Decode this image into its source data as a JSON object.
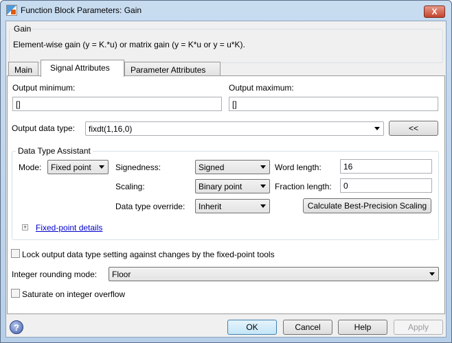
{
  "window": {
    "title": "Function Block Parameters: Gain",
    "close": "X"
  },
  "block": {
    "group_label": "Gain",
    "description": "Element-wise gain (y = K.*u) or matrix gain (y = K*u or y = u*K)."
  },
  "tabs": [
    {
      "label": "Main"
    },
    {
      "label": "Signal Attributes"
    },
    {
      "label": "Parameter Attributes"
    }
  ],
  "signal": {
    "out_min_label": "Output minimum:",
    "out_min_value": "[]",
    "out_max_label": "Output maximum:",
    "out_max_value": "[]",
    "out_type_label": "Output data type:",
    "out_type_value": "fixdt(1,16,0)",
    "assistant_toggle": "<<",
    "assistant": {
      "label": "Data Type Assistant",
      "mode_label": "Mode:",
      "mode_value": "Fixed point",
      "signedness_label": "Signedness:",
      "signedness_value": "Signed",
      "word_length_label": "Word length:",
      "word_length_value": "16",
      "scaling_label": "Scaling:",
      "scaling_value": "Binary point",
      "fraction_length_label": "Fraction length:",
      "fraction_length_value": "0",
      "override_label": "Data type override:",
      "override_value": "Inherit",
      "calc_button": "Calculate Best-Precision Scaling",
      "details_expander": "+",
      "details_link": "Fixed-point details"
    },
    "lock_label": "Lock output data type setting against changes by the fixed-point tools",
    "lock_checked": false,
    "rounding_label": "Integer rounding mode:",
    "rounding_value": "Floor",
    "saturate_label": "Saturate on integer overflow",
    "saturate_checked": false
  },
  "footer": {
    "help_icon": "?",
    "ok": "OK",
    "cancel": "Cancel",
    "help": "Help",
    "apply": "Apply"
  }
}
